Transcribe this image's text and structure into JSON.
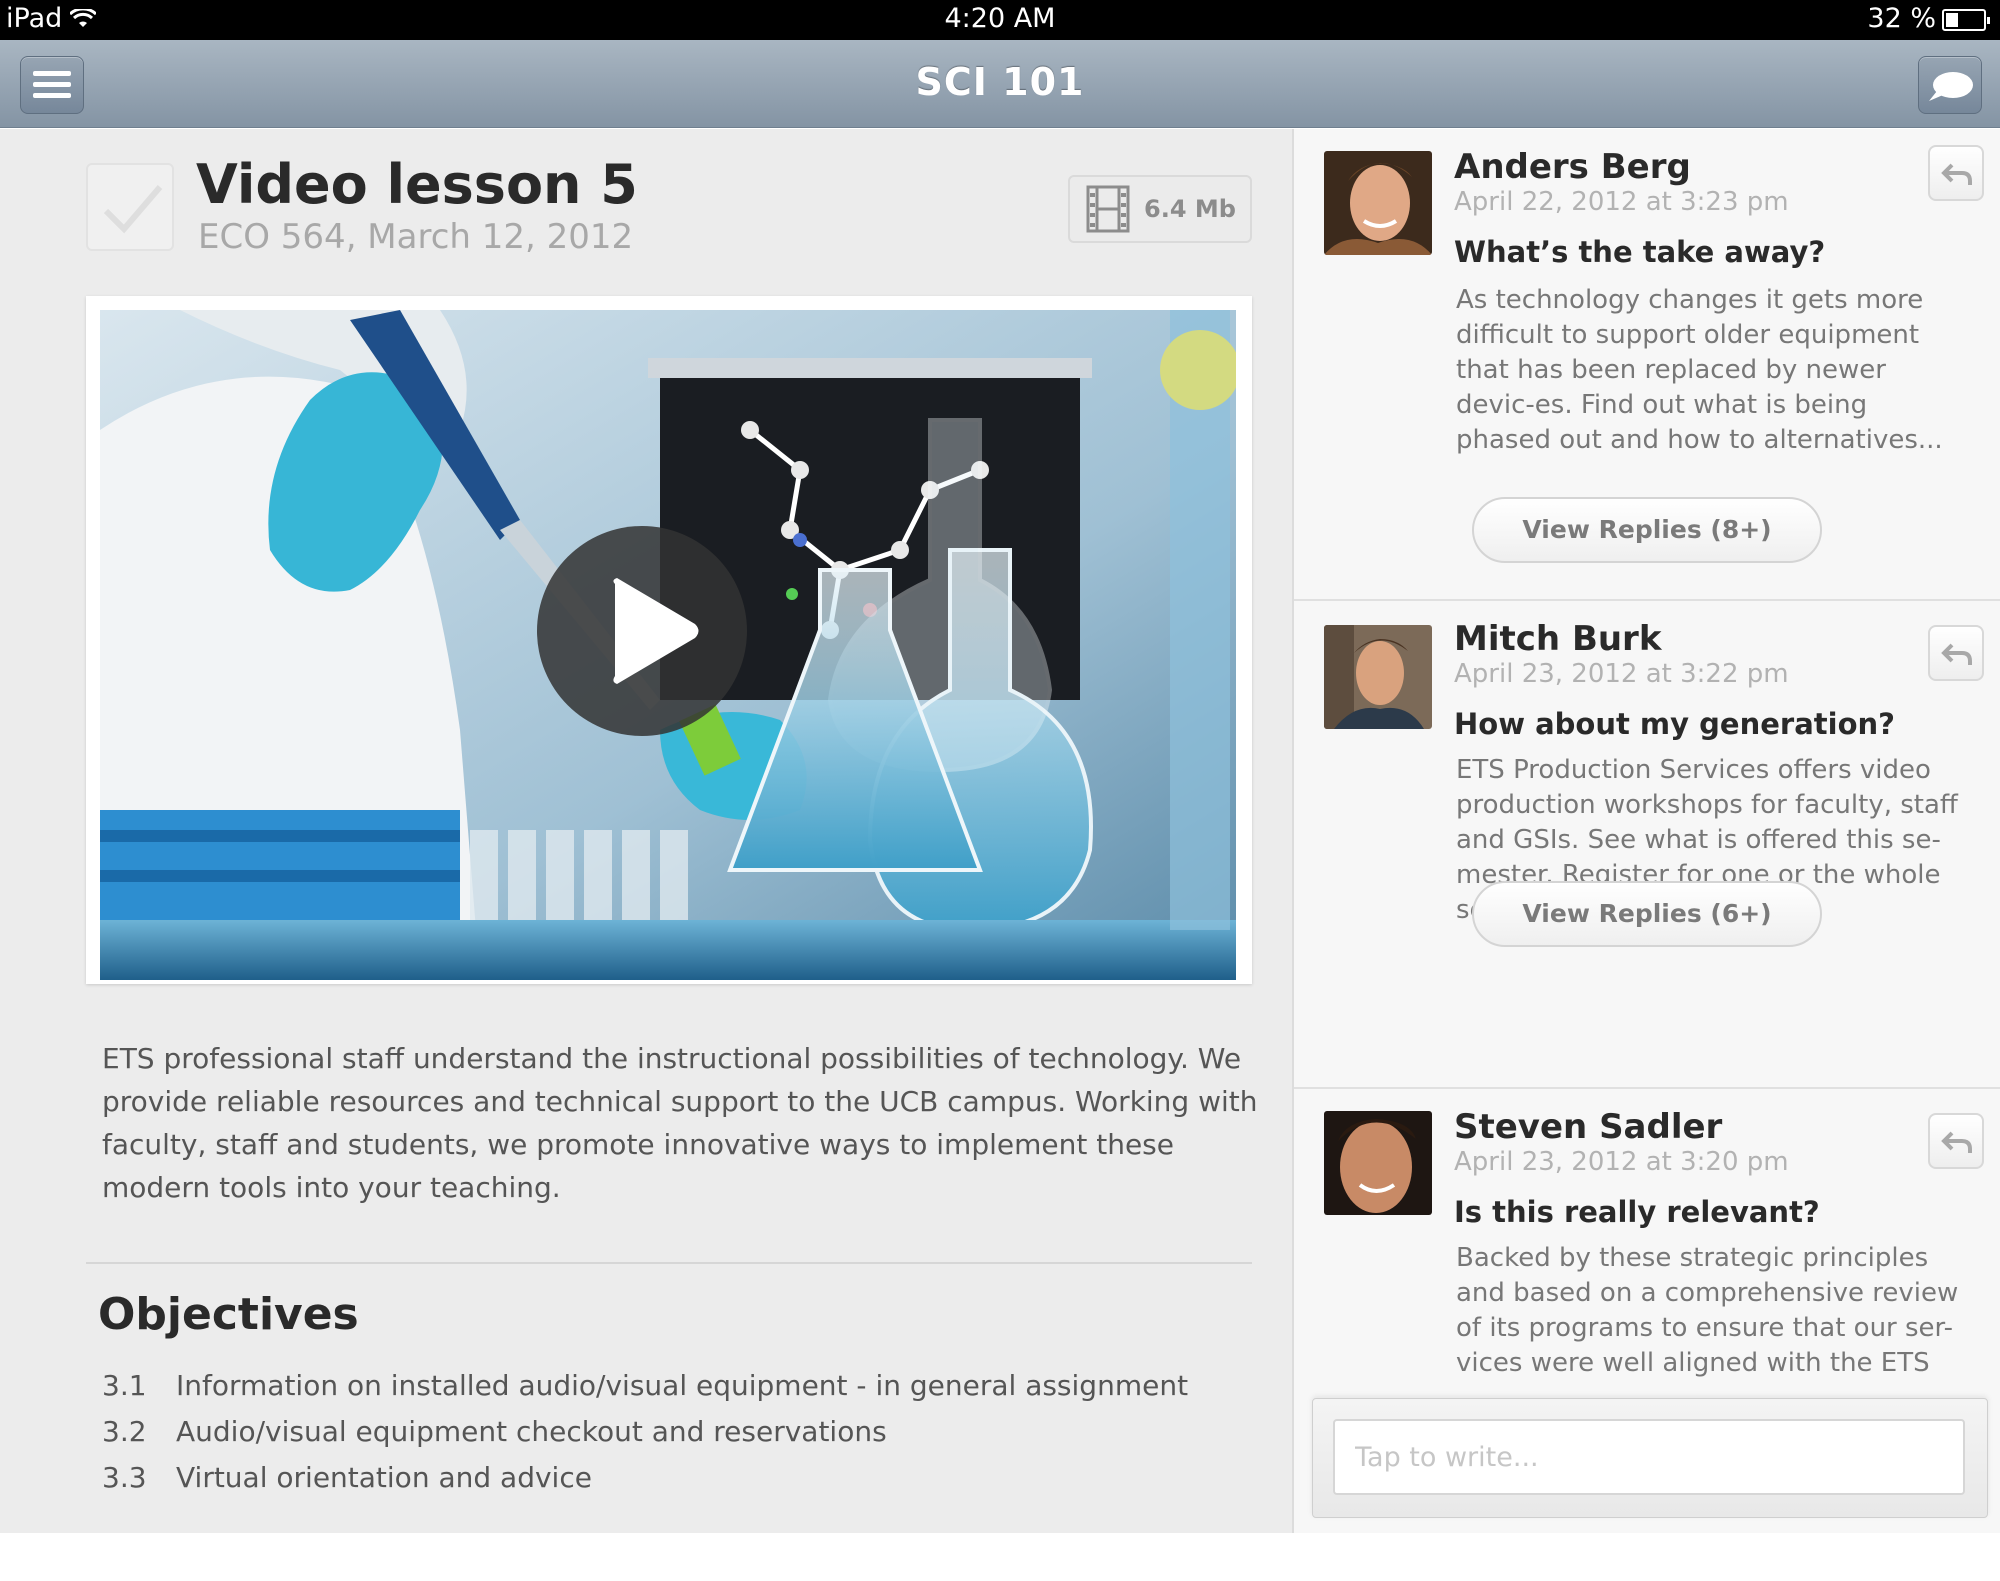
{
  "status_bar": {
    "device": "iPad",
    "time": "4:20 AM",
    "battery_text": "32 %",
    "battery_level": 0.32
  },
  "nav": {
    "title": "SCI 101",
    "menu_icon": "hamburger-menu-icon",
    "chat_icon": "chat-bubble-icon"
  },
  "lesson": {
    "title": "Video lesson 5",
    "subtitle": "ECO 564, March 12, 2012",
    "file_size": "6.4 Mb",
    "description": "ETS professional staff understand the instructional possibilities of technology. We provide reliable resources and technical support to the UCB campus. Working with faculty, staff and students, we promote innovative ways to implement these modern tools into your teaching."
  },
  "objectives": {
    "heading": "Objectives",
    "items": [
      {
        "num": "3.1",
        "text": "Information on installed audio/visual equipment - in general assignment"
      },
      {
        "num": "3.2",
        "text": "Audio/visual equipment checkout and reservations"
      },
      {
        "num": "3.3",
        "text": "Virtual orientation and advice"
      }
    ]
  },
  "posts": [
    {
      "author": "Anders Berg",
      "date": "April 22, 2012 at 3:23 pm",
      "topic": "What’s the take away?",
      "body": "As technology changes it gets more difficult to support older equipment that has been replaced by newer devic-es. Find out what is being phased out and how to alternatives...",
      "replies_label": "View Replies (8+)"
    },
    {
      "author": "Mitch Burk",
      "date": "April 23, 2012 at 3:22 pm",
      "topic": "How about my generation?",
      "body": "ETS Production Services offers video production workshops for faculty, staff and GSIs. See what is offered this se-mester. Register for one or the whole series.",
      "replies_label": "View Replies (6+)"
    },
    {
      "author": "Steven Sadler",
      "date": "April 23, 2012 at 3:20 pm",
      "topic": "Is this really relevant?",
      "body": "Backed by these strategic principles and based on a comprehensive review of its programs to ensure that our ser-vices were well aligned with the ETS"
    }
  ],
  "compose": {
    "placeholder": "Tap to write..."
  }
}
